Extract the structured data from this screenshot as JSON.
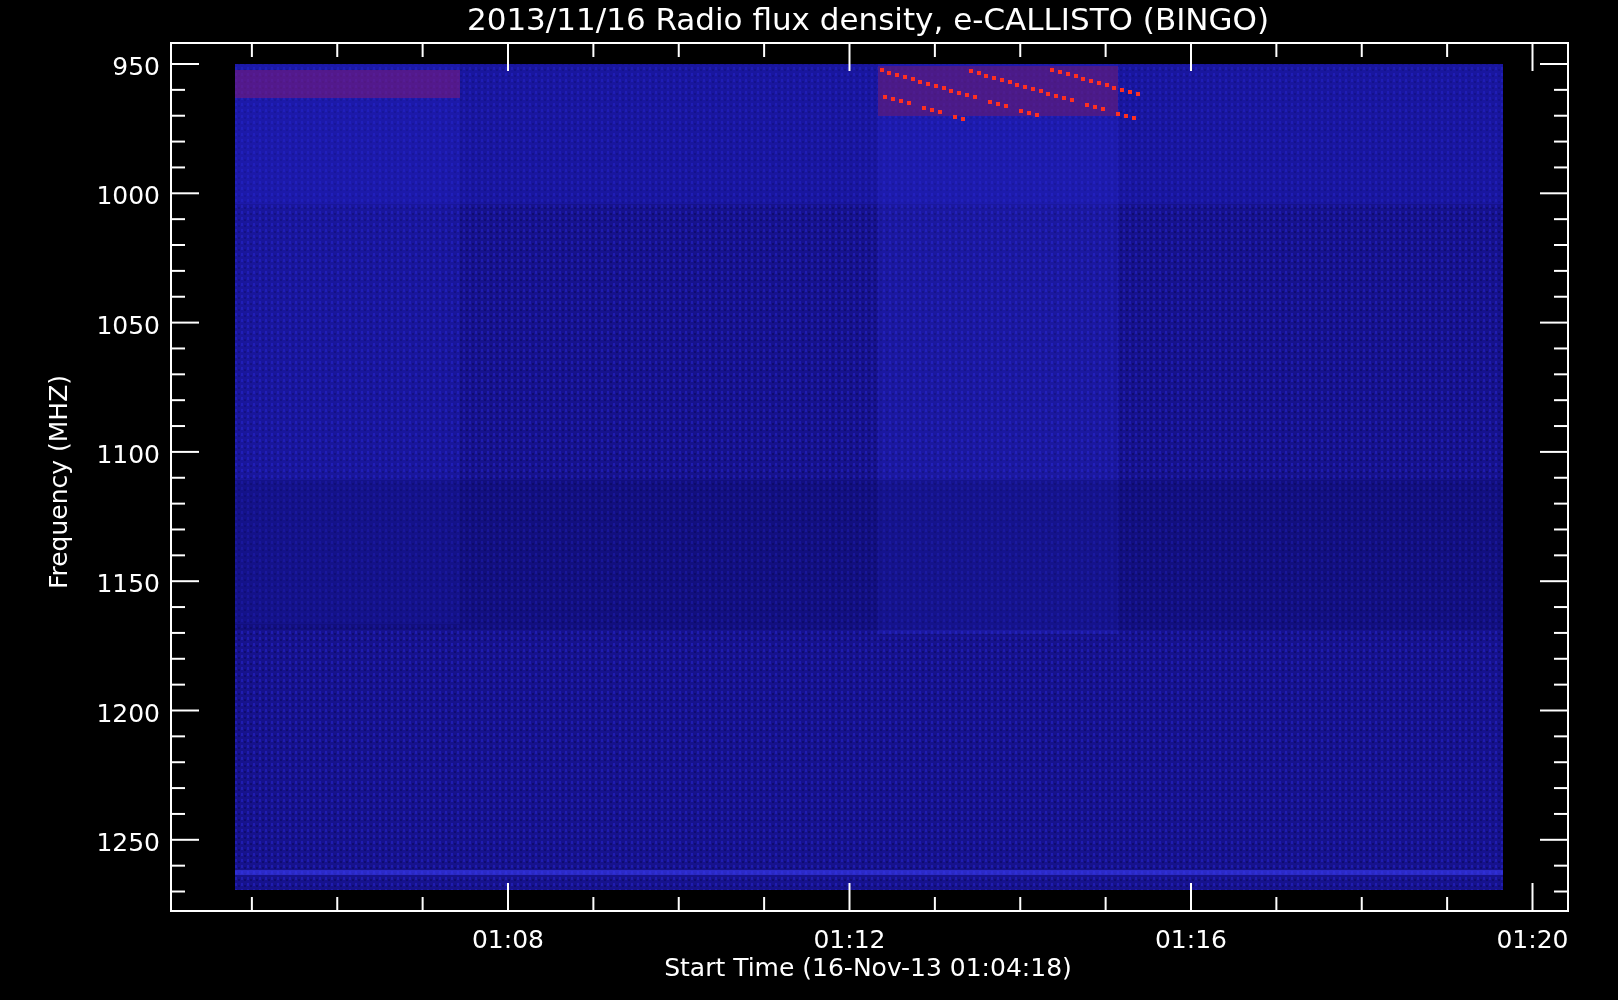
{
  "chart": {
    "title": "2013/11/16  Radio flux density, e-CALLISTO (BINGO)",
    "xlabel": "Start Time (16-Nov-13 01:04:18)",
    "ylabel": "Frequency (MHZ)",
    "yticks": [
      "950",
      "1000",
      "1050",
      "1100",
      "1150",
      "1200",
      "1250"
    ],
    "xticks": [
      "01:08",
      "01:12",
      "01:16",
      "01:20"
    ]
  }
}
